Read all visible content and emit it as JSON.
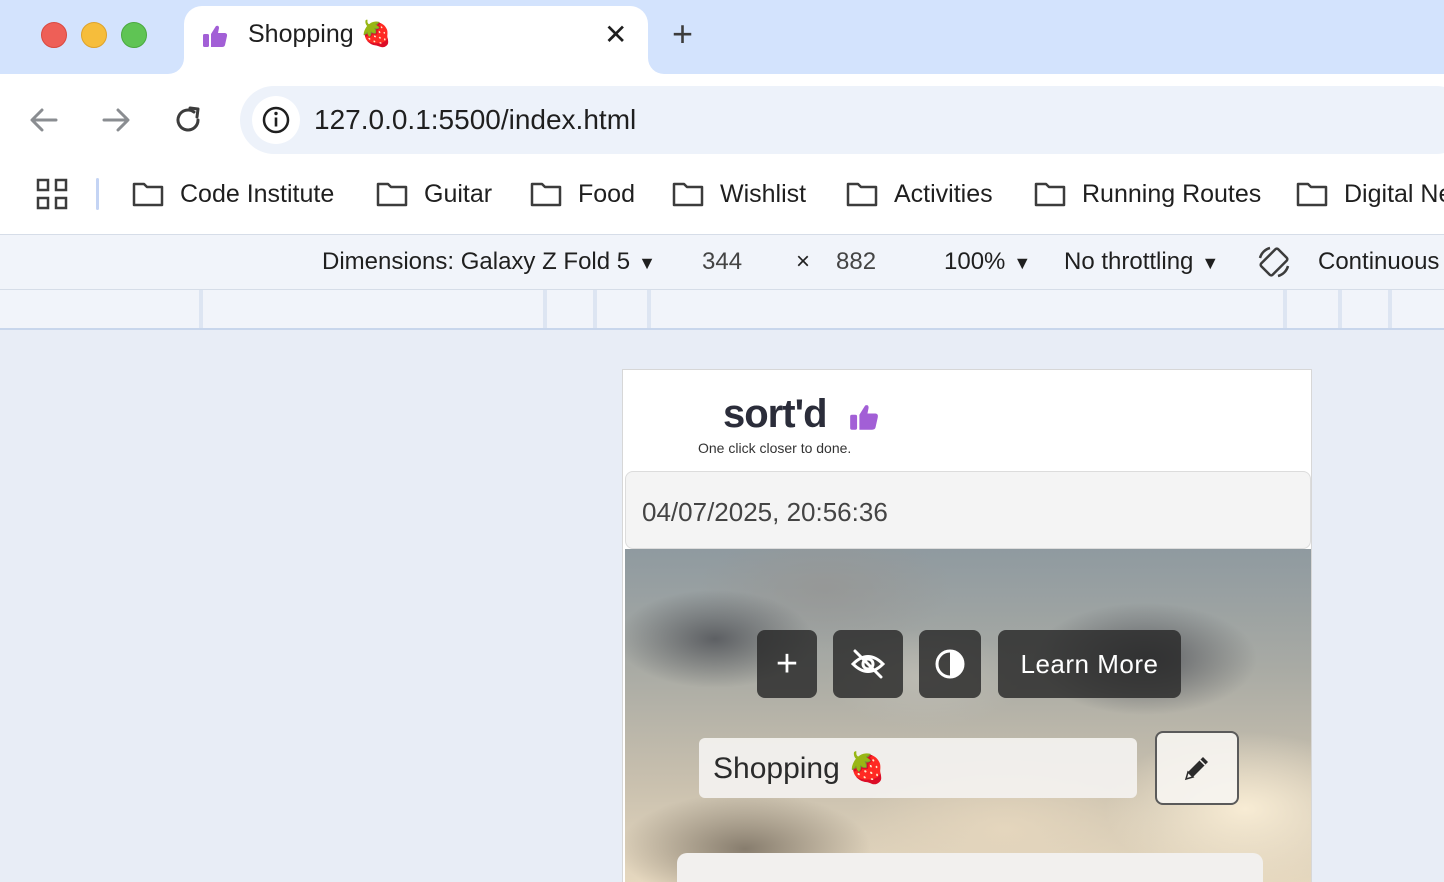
{
  "tab": {
    "title": "Shopping 🍓",
    "close": "✕",
    "new_tab": "+"
  },
  "toolbar": {
    "url": "127.0.0.1:5500/index.html"
  },
  "bookmarks": [
    "Code Institute",
    "Guitar",
    "Food",
    "Wishlist",
    "Activities",
    "Running Routes",
    "Digital Ne"
  ],
  "device_toolbar": {
    "dimensions": "Dimensions: Galaxy Z Fold 5",
    "width": "344",
    "times": "×",
    "height": "882",
    "zoom": "100%",
    "throttling": "No throttling",
    "mode": "Continuous"
  },
  "page": {
    "logo": "sort'd",
    "tagline": "One click closer to done.",
    "datetime": "04/07/2025, 20:56:36",
    "buttons": {
      "add": "+",
      "learn_more": "Learn More"
    },
    "list_name": "Shopping 🍓"
  },
  "colors": {
    "accent": "#a25fd6",
    "tab_strip": "#d3e3fd",
    "omnibox": "#edf2fa"
  }
}
